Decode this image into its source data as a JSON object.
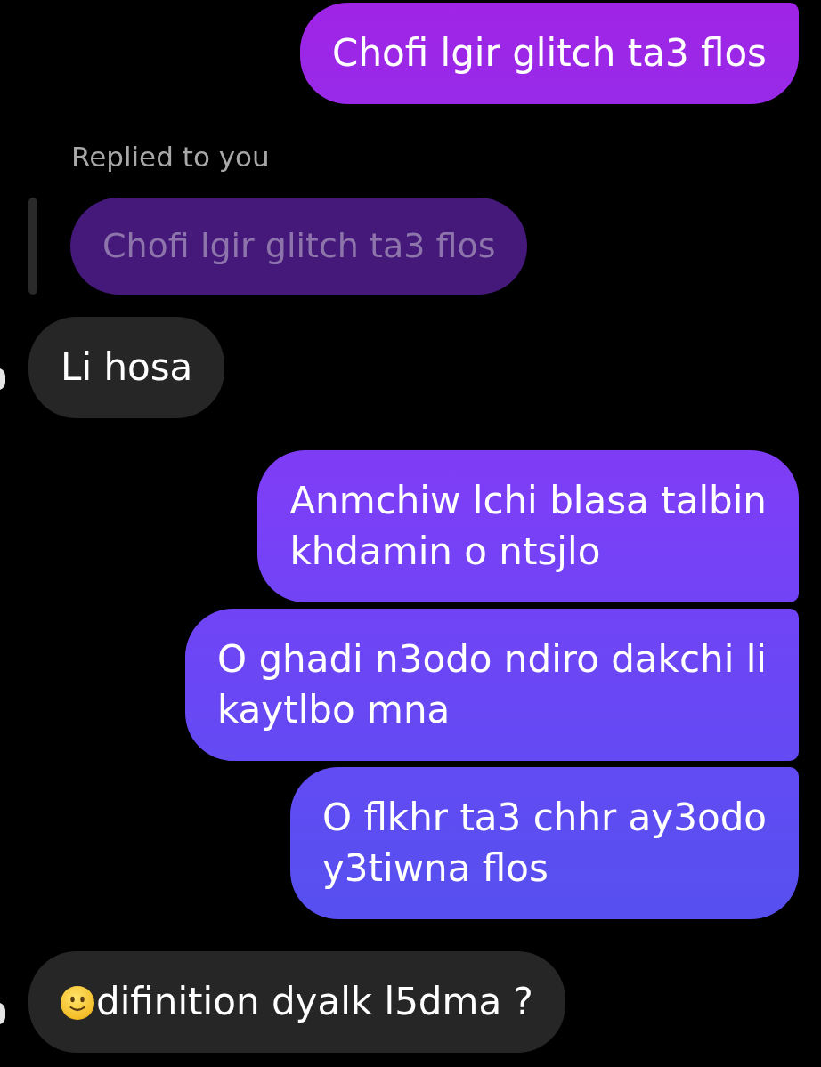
{
  "messages": [
    {
      "kind": "outgoing",
      "joined_above": true,
      "joined_below": false,
      "lines": [
        "Chofi lgir glitch ta3 flos"
      ]
    },
    {
      "kind": "incoming",
      "joined_above": false,
      "joined_below": false,
      "reply": {
        "label": "Replied to you",
        "quote": "Chofi lgir glitch ta3 flos"
      },
      "lines": [
        "Li hosa"
      ]
    },
    {
      "kind": "outgoing",
      "joined_above": false,
      "joined_below": true,
      "lines": [
        "Anmchiw lchi blasa talbin",
        "khdamin o ntsjlo"
      ]
    },
    {
      "kind": "outgoing",
      "joined_above": true,
      "joined_below": true,
      "lines": [
        "O ghadi n3odo ndiro dakchi li",
        "kaytlbo mna"
      ]
    },
    {
      "kind": "outgoing",
      "joined_above": true,
      "joined_below": false,
      "lines": [
        "O flkhr ta3 chhr ay3odo",
        "y3tiwna flos"
      ]
    },
    {
      "kind": "incoming",
      "joined_above": false,
      "joined_below": false,
      "leading_emoji": true,
      "lines": [
        "difinition dyalk l5dma ?"
      ]
    }
  ]
}
